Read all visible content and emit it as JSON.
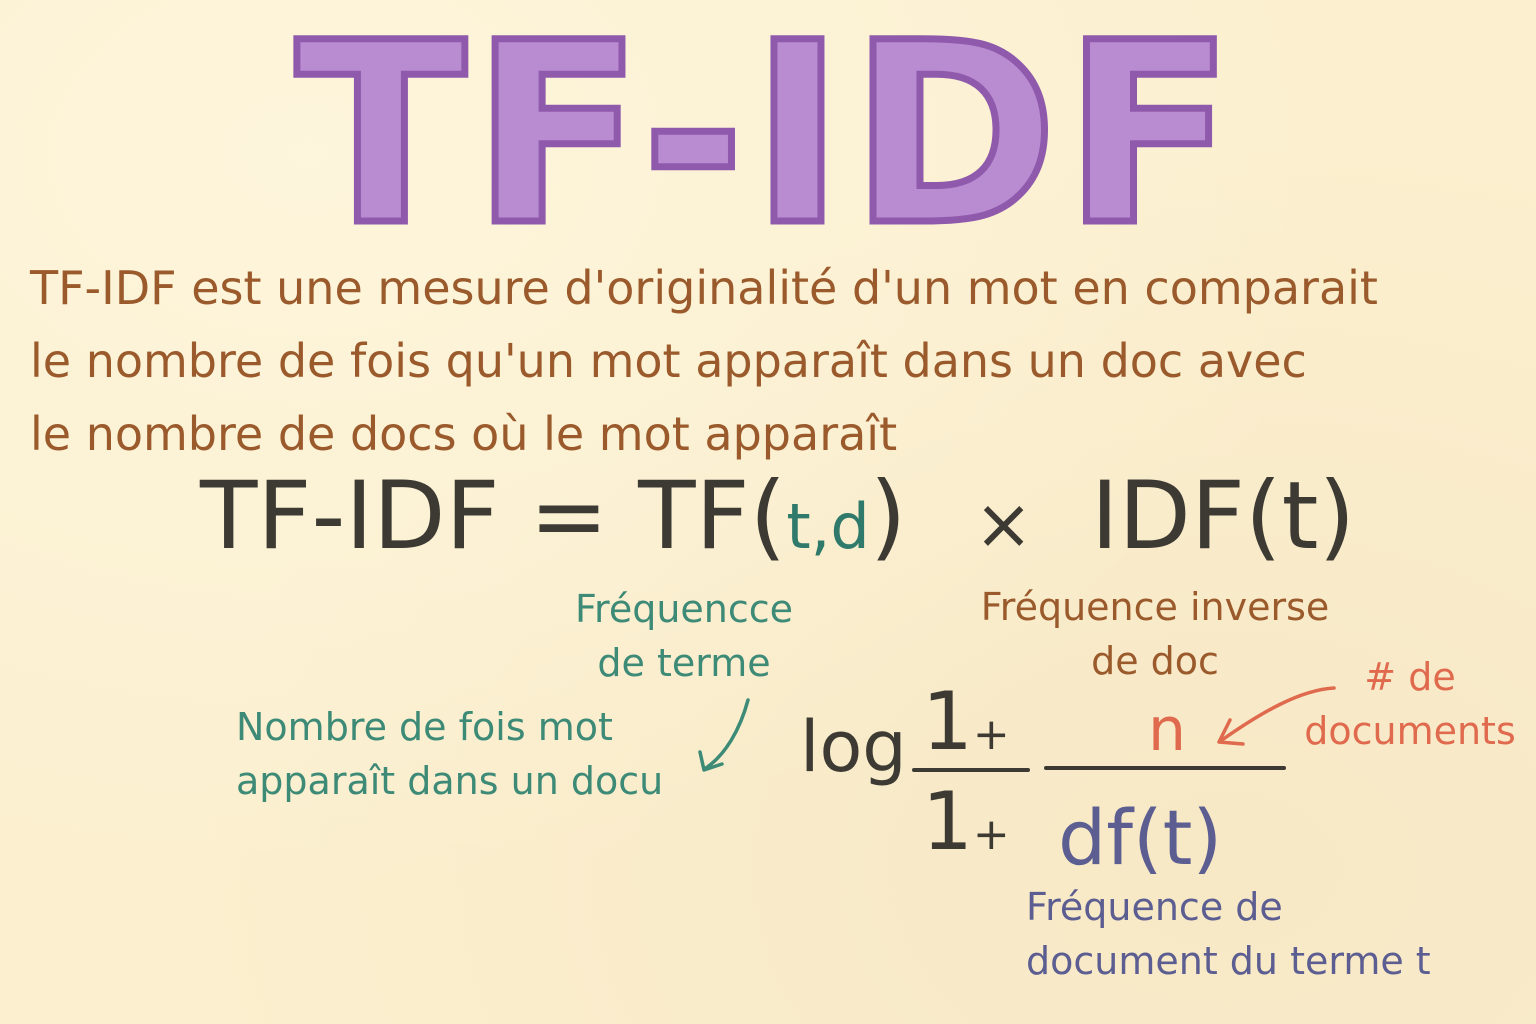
{
  "title": "TF-IDF",
  "description": {
    "line1": "TF-IDF est une mesure d'originalité d'un mot en comparait",
    "line2": "le nombre de fois qu'un mot apparaît dans un doc avec",
    "line3": "le nombre de docs où le mot apparaît"
  },
  "equation": {
    "lhs": "TF-IDF",
    "equals": "=",
    "tf": "TF",
    "open_paren": "(",
    "tf_args": "t,d",
    "close_paren": ")",
    "times": "×",
    "idf": "IDF(t)"
  },
  "labels": {
    "tf_name_line1": "Fréquencce",
    "tf_name_line2": "de terme",
    "tf_desc_line1": "Nombre de fois mot",
    "tf_desc_line2": "apparaît dans un docu",
    "idf_name_line1": "Fréquence inverse",
    "idf_name_line2": "de doc",
    "n_desc_line1": "# de",
    "n_desc_line2": "documents",
    "df_desc_line1": "Fréquence de",
    "df_desc_line2": "document du terme t"
  },
  "formula": {
    "log": "log",
    "num_one": "1",
    "num_plus": "+",
    "n": "n",
    "den_one": "1",
    "den_plus": "+",
    "df": "df(t)"
  },
  "colors": {
    "background": "#fbefcf",
    "title_fill": "#b98bd1",
    "title_outline": "#8f5aac",
    "description": "#9a5a2c",
    "equation": "#3c3a33",
    "teal": "#3d8a77",
    "brown": "#9a5a2c",
    "red": "#e06a4e",
    "blue": "#5c5e92"
  }
}
